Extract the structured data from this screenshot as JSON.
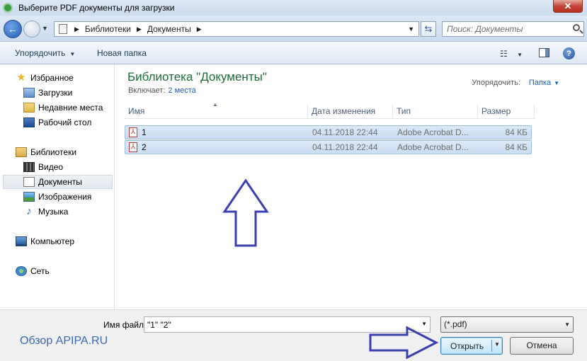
{
  "window": {
    "title": "Выберите PDF документы для загрузки",
    "close_glyph": "✕"
  },
  "address": {
    "crumbs": [
      "Библиотеки",
      "Документы"
    ],
    "search_placeholder": "Поиск: Документы"
  },
  "toolbar": {
    "organize_label": "Упорядочить",
    "new_folder_label": "Новая папка"
  },
  "nav": {
    "favorites": {
      "label": "Избранное",
      "items": [
        "Загрузки",
        "Недавние места",
        "Рабочий стол"
      ]
    },
    "libraries": {
      "label": "Библиотеки",
      "items": [
        "Видео",
        "Документы",
        "Изображения",
        "Музыка"
      ]
    },
    "computer": "Компьютер",
    "network": "Сеть"
  },
  "content": {
    "title": "Библиотека \"Документы\"",
    "includes_label": "Включает:",
    "includes_link": "2 места",
    "arrange_label": "Упорядочить:",
    "arrange_value": "Папка",
    "columns": [
      "Имя",
      "Дата изменения",
      "Тип",
      "Размер"
    ],
    "files": [
      {
        "name": "1",
        "date": "04.11.2018 22:44",
        "type": "Adobe Acrobat D...",
        "size": "84 КБ"
      },
      {
        "name": "2",
        "date": "04.11.2018 22:44",
        "type": "Adobe Acrobat D...",
        "size": "84 КБ"
      }
    ]
  },
  "bottom": {
    "filename_label": "Имя файла:",
    "filename_value": "\"1\" \"2\"",
    "filetype_value": "(*.pdf)",
    "open_label": "Открыть",
    "cancel_label": "Отмена",
    "watermark": "Обзор APIPA.RU"
  },
  "colors": {
    "annotation_arrow": "#3a3fb0",
    "library_title": "#1e6a39",
    "link": "#1a5fb4"
  }
}
